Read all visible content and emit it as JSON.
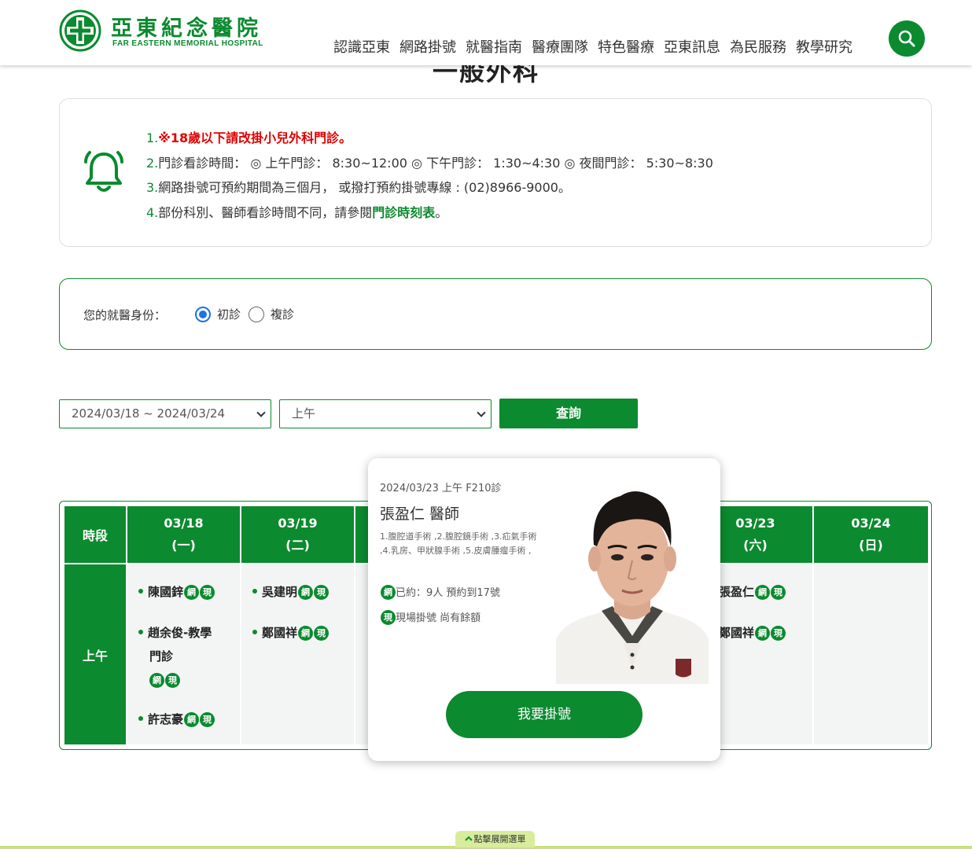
{
  "header": {
    "logo_cn": "亞東紀念醫院",
    "logo_en": "FAR EASTERN MEMORIAL HOSPITAL",
    "nav": [
      "認識亞東",
      "網路掛號",
      "就醫指南",
      "醫療團隊",
      "特色醫療",
      "亞東訊息",
      "為民服務",
      "教學研究"
    ]
  },
  "page_title": "一般外科",
  "notice": {
    "items": [
      {
        "num": "1.",
        "text": "※18歲以下請改掛小兒外科門診。"
      },
      {
        "num": "2.",
        "text": "門診看診時間： ◎ 上午門診： 8:30~12:00 ◎ 下午門診： 1:30~4:30 ◎ 夜間門診： 5:30~8:30"
      },
      {
        "num": "3.",
        "text": "網路掛號可預約期間為三個月， 或撥打預約掛號專線 : (02)8966-9000。"
      },
      {
        "num": "4.",
        "text_before": "部份科別、醫師看診時間不同，請參閱",
        "link": "門診時刻表",
        "text_after": "。"
      }
    ]
  },
  "identity": {
    "label": "您的就醫身份：",
    "options": [
      "初診",
      "複診"
    ],
    "selected": "初診"
  },
  "filters": {
    "date_range": "2024/03/18 ~ 2024/03/24",
    "period": "上午",
    "query_label": "查詢"
  },
  "schedule": {
    "period_header": "時段",
    "period": "上午",
    "tag_web": "網",
    "tag_onsite": "現",
    "days": [
      {
        "date": "03/18",
        "weekday": "(一)",
        "doctors": [
          "陳國鋅",
          "趙余俊-教學",
          "門診",
          "許志豪"
        ]
      },
      {
        "date": "03/19",
        "weekday": "(二)",
        "doctors": [
          "吳建明",
          "鄭國祥"
        ]
      },
      {
        "date": "03/23",
        "weekday": "(六)",
        "doctors": [
          "張盈仁",
          "鄭國祥"
        ]
      },
      {
        "date": "03/24",
        "weekday": "(日)",
        "doctors": []
      }
    ]
  },
  "popup": {
    "meta": "2024/03/23 上午 F210診",
    "name": "張盈仁 醫師",
    "specialty": "1.腹腔道手術 ,2.腹腔鏡手術 ,3.疝氣手術 ,4.乳房、甲狀腺手術 ,5.皮膚腫瘤手術 ,",
    "web_status": "已約：9人 預約到17號",
    "onsite_status": "現場掛號 尚有餘額",
    "book_label": "我要掛號"
  },
  "footer": {
    "expand_label": "點擊展開選單"
  },
  "colors": {
    "brand_green": "#0b8a2f",
    "warning_red": "#e00000",
    "cell_bg": "#f2f5f4"
  }
}
